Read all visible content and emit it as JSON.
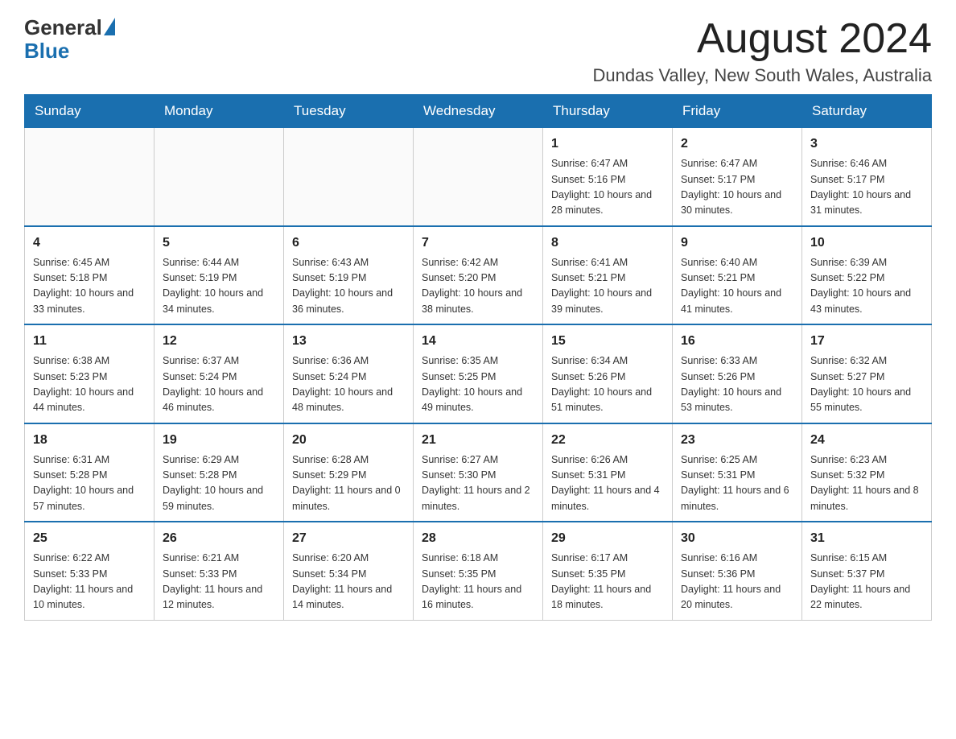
{
  "header": {
    "logo": {
      "text_general": "General",
      "text_blue": "Blue",
      "aria": "GeneralBlue logo"
    },
    "title": "August 2024",
    "location": "Dundas Valley, New South Wales, Australia"
  },
  "calendar": {
    "weekdays": [
      "Sunday",
      "Monday",
      "Tuesday",
      "Wednesday",
      "Thursday",
      "Friday",
      "Saturday"
    ],
    "weeks": [
      [
        {
          "day": "",
          "info": ""
        },
        {
          "day": "",
          "info": ""
        },
        {
          "day": "",
          "info": ""
        },
        {
          "day": "",
          "info": ""
        },
        {
          "day": "1",
          "info": "Sunrise: 6:47 AM\nSunset: 5:16 PM\nDaylight: 10 hours and 28 minutes."
        },
        {
          "day": "2",
          "info": "Sunrise: 6:47 AM\nSunset: 5:17 PM\nDaylight: 10 hours and 30 minutes."
        },
        {
          "day": "3",
          "info": "Sunrise: 6:46 AM\nSunset: 5:17 PM\nDaylight: 10 hours and 31 minutes."
        }
      ],
      [
        {
          "day": "4",
          "info": "Sunrise: 6:45 AM\nSunset: 5:18 PM\nDaylight: 10 hours and 33 minutes."
        },
        {
          "day": "5",
          "info": "Sunrise: 6:44 AM\nSunset: 5:19 PM\nDaylight: 10 hours and 34 minutes."
        },
        {
          "day": "6",
          "info": "Sunrise: 6:43 AM\nSunset: 5:19 PM\nDaylight: 10 hours and 36 minutes."
        },
        {
          "day": "7",
          "info": "Sunrise: 6:42 AM\nSunset: 5:20 PM\nDaylight: 10 hours and 38 minutes."
        },
        {
          "day": "8",
          "info": "Sunrise: 6:41 AM\nSunset: 5:21 PM\nDaylight: 10 hours and 39 minutes."
        },
        {
          "day": "9",
          "info": "Sunrise: 6:40 AM\nSunset: 5:21 PM\nDaylight: 10 hours and 41 minutes."
        },
        {
          "day": "10",
          "info": "Sunrise: 6:39 AM\nSunset: 5:22 PM\nDaylight: 10 hours and 43 minutes."
        }
      ],
      [
        {
          "day": "11",
          "info": "Sunrise: 6:38 AM\nSunset: 5:23 PM\nDaylight: 10 hours and 44 minutes."
        },
        {
          "day": "12",
          "info": "Sunrise: 6:37 AM\nSunset: 5:24 PM\nDaylight: 10 hours and 46 minutes."
        },
        {
          "day": "13",
          "info": "Sunrise: 6:36 AM\nSunset: 5:24 PM\nDaylight: 10 hours and 48 minutes."
        },
        {
          "day": "14",
          "info": "Sunrise: 6:35 AM\nSunset: 5:25 PM\nDaylight: 10 hours and 49 minutes."
        },
        {
          "day": "15",
          "info": "Sunrise: 6:34 AM\nSunset: 5:26 PM\nDaylight: 10 hours and 51 minutes."
        },
        {
          "day": "16",
          "info": "Sunrise: 6:33 AM\nSunset: 5:26 PM\nDaylight: 10 hours and 53 minutes."
        },
        {
          "day": "17",
          "info": "Sunrise: 6:32 AM\nSunset: 5:27 PM\nDaylight: 10 hours and 55 minutes."
        }
      ],
      [
        {
          "day": "18",
          "info": "Sunrise: 6:31 AM\nSunset: 5:28 PM\nDaylight: 10 hours and 57 minutes."
        },
        {
          "day": "19",
          "info": "Sunrise: 6:29 AM\nSunset: 5:28 PM\nDaylight: 10 hours and 59 minutes."
        },
        {
          "day": "20",
          "info": "Sunrise: 6:28 AM\nSunset: 5:29 PM\nDaylight: 11 hours and 0 minutes."
        },
        {
          "day": "21",
          "info": "Sunrise: 6:27 AM\nSunset: 5:30 PM\nDaylight: 11 hours and 2 minutes."
        },
        {
          "day": "22",
          "info": "Sunrise: 6:26 AM\nSunset: 5:31 PM\nDaylight: 11 hours and 4 minutes."
        },
        {
          "day": "23",
          "info": "Sunrise: 6:25 AM\nSunset: 5:31 PM\nDaylight: 11 hours and 6 minutes."
        },
        {
          "day": "24",
          "info": "Sunrise: 6:23 AM\nSunset: 5:32 PM\nDaylight: 11 hours and 8 minutes."
        }
      ],
      [
        {
          "day": "25",
          "info": "Sunrise: 6:22 AM\nSunset: 5:33 PM\nDaylight: 11 hours and 10 minutes."
        },
        {
          "day": "26",
          "info": "Sunrise: 6:21 AM\nSunset: 5:33 PM\nDaylight: 11 hours and 12 minutes."
        },
        {
          "day": "27",
          "info": "Sunrise: 6:20 AM\nSunset: 5:34 PM\nDaylight: 11 hours and 14 minutes."
        },
        {
          "day": "28",
          "info": "Sunrise: 6:18 AM\nSunset: 5:35 PM\nDaylight: 11 hours and 16 minutes."
        },
        {
          "day": "29",
          "info": "Sunrise: 6:17 AM\nSunset: 5:35 PM\nDaylight: 11 hours and 18 minutes."
        },
        {
          "day": "30",
          "info": "Sunrise: 6:16 AM\nSunset: 5:36 PM\nDaylight: 11 hours and 20 minutes."
        },
        {
          "day": "31",
          "info": "Sunrise: 6:15 AM\nSunset: 5:37 PM\nDaylight: 11 hours and 22 minutes."
        }
      ]
    ]
  }
}
